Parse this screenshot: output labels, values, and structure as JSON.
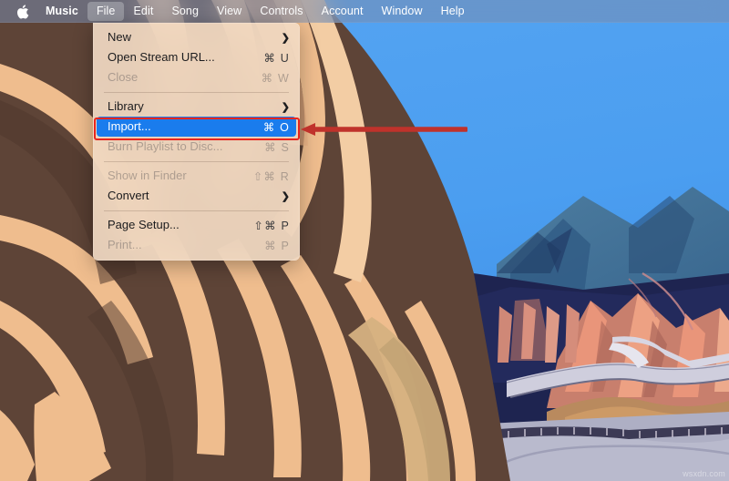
{
  "menubar": {
    "apple_icon": "apple-logo-icon",
    "items": [
      {
        "label": "Music",
        "bold": true,
        "active": false
      },
      {
        "label": "File",
        "bold": false,
        "active": true
      },
      {
        "label": "Edit",
        "bold": false,
        "active": false
      },
      {
        "label": "Song",
        "bold": false,
        "active": false
      },
      {
        "label": "View",
        "bold": false,
        "active": false
      },
      {
        "label": "Controls",
        "bold": false,
        "active": false
      },
      {
        "label": "Account",
        "bold": false,
        "active": false
      },
      {
        "label": "Window",
        "bold": false,
        "active": false
      },
      {
        "label": "Help",
        "bold": false,
        "active": false
      }
    ]
  },
  "file_menu": {
    "title": "File",
    "items": [
      {
        "type": "item",
        "label": "New",
        "shortcut": "",
        "submenu": true,
        "disabled": false,
        "selected": false
      },
      {
        "type": "item",
        "label": "Open Stream URL...",
        "shortcut": "⌘ U",
        "submenu": false,
        "disabled": false,
        "selected": false
      },
      {
        "type": "item",
        "label": "Close",
        "shortcut": "⌘ W",
        "submenu": false,
        "disabled": true,
        "selected": false
      },
      {
        "type": "separator"
      },
      {
        "type": "item",
        "label": "Library",
        "shortcut": "",
        "submenu": true,
        "disabled": false,
        "selected": false
      },
      {
        "type": "item",
        "label": "Import...",
        "shortcut": "⌘ O",
        "submenu": false,
        "disabled": false,
        "selected": true
      },
      {
        "type": "item",
        "label": "Burn Playlist to Disc...",
        "shortcut": "⌘ S",
        "submenu": false,
        "disabled": true,
        "selected": false
      },
      {
        "type": "separator"
      },
      {
        "type": "item",
        "label": "Show in Finder",
        "shortcut": "⇧⌘ R",
        "submenu": false,
        "disabled": true,
        "selected": false
      },
      {
        "type": "item",
        "label": "Convert",
        "shortcut": "",
        "submenu": true,
        "disabled": false,
        "selected": false
      },
      {
        "type": "separator"
      },
      {
        "type": "item",
        "label": "Page Setup...",
        "shortcut": "⇧⌘ P",
        "submenu": false,
        "disabled": false,
        "selected": false
      },
      {
        "type": "item",
        "label": "Print...",
        "shortcut": "⌘ P",
        "submenu": false,
        "disabled": true,
        "selected": false
      }
    ]
  },
  "annotations": {
    "highlight_box_color": "#e8251d",
    "arrow_color": "#c0322b",
    "arrow_direction": "left",
    "arrow_target": "Import..."
  },
  "watermark": {
    "text": "wsxdn.com"
  },
  "colors": {
    "menubar_tint": "#788caf",
    "menu_background": "#f3ddc7",
    "selection_blue": "#1a7ced",
    "sky_blue": "#4b9ef0",
    "cliff_tan": "#efbd8e",
    "cliff_brown": "#5e4437",
    "mesa_salmon": "#e9957a",
    "valley_navy": "#1e2450"
  }
}
